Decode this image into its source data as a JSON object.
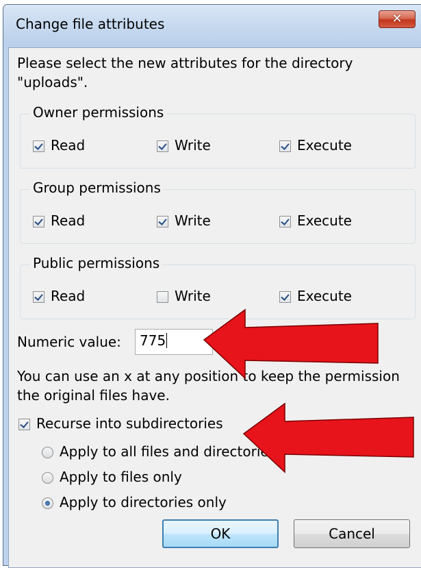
{
  "dialog": {
    "title": "Change file attributes",
    "close_label": "✕",
    "description_line1": "Please select the new attributes for the directory",
    "description_line2": "\"uploads\"."
  },
  "groups": [
    {
      "legend": "Owner permissions",
      "read": {
        "label": "Read",
        "checked": true
      },
      "write": {
        "label": "Write",
        "checked": true
      },
      "execute": {
        "label": "Execute",
        "checked": true
      }
    },
    {
      "legend": "Group permissions",
      "read": {
        "label": "Read",
        "checked": true
      },
      "write": {
        "label": "Write",
        "checked": true
      },
      "execute": {
        "label": "Execute",
        "checked": true
      }
    },
    {
      "legend": "Public permissions",
      "read": {
        "label": "Read",
        "checked": true
      },
      "write": {
        "label": "Write",
        "checked": false
      },
      "execute": {
        "label": "Execute",
        "checked": true
      }
    }
  ],
  "numeric": {
    "label": "Numeric value:",
    "value": "775"
  },
  "hint_line1": "You can use an x at any position to keep the permission",
  "hint_line2": "the original files have.",
  "recurse": {
    "label": "Recurse into subdirectories",
    "checked": true
  },
  "apply_options": [
    {
      "label": "Apply to all files and directories",
      "selected": false
    },
    {
      "label": "Apply to files only",
      "selected": false
    },
    {
      "label": "Apply to directories only",
      "selected": true
    }
  ],
  "buttons": {
    "ok": "OK",
    "cancel": "Cancel"
  },
  "colors": {
    "annotation_arrow": "#e8141b",
    "accent": "#3c7fb1"
  }
}
